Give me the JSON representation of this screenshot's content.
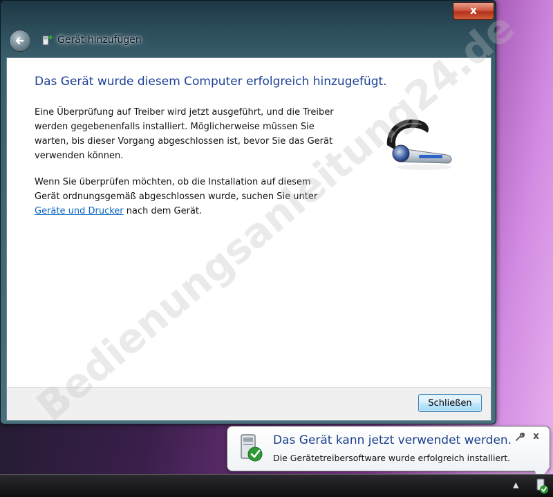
{
  "window": {
    "title": "Gerät hinzufügen",
    "close_label": "x"
  },
  "content": {
    "heading": "Das Gerät wurde diesem Computer erfolgreich hinzugefügt.",
    "paragraph1": "Eine Überprüfung auf Treiber wird jetzt ausgeführt, und die Treiber werden gegebenenfalls installiert. Möglicherweise müssen Sie warten, bis dieser Vorgang abgeschlossen ist, bevor Sie das Gerät verwenden können.",
    "paragraph2_before": "Wenn Sie überprüfen möchten, ob die Installation auf diesem Gerät ordnungsgemäß abgeschlossen wurde, suchen Sie unter",
    "paragraph2_link": "Geräte und Drucker",
    "paragraph2_after": " nach dem Gerät."
  },
  "footer": {
    "close_button": "Schließen"
  },
  "watermark": "Bedienungsanleitung24.de",
  "notification": {
    "title": "Das Gerät kann jetzt verwendet werden.",
    "text": "Die Gerätetreibersoftware wurde erfolgreich installiert.",
    "close_label": "x"
  },
  "taskbar": {
    "tray_arrow": "▲"
  },
  "icons": {
    "back": "back-arrow-icon",
    "title": "add-device-icon",
    "device": "headset-icon",
    "notification": "device-installed-icon",
    "wrench": "wrench-icon",
    "tray": "device-tray-icon"
  },
  "colors": {
    "heading": "#1c3f94",
    "link": "#0b66c2",
    "close_button_red": "#b3311c"
  }
}
